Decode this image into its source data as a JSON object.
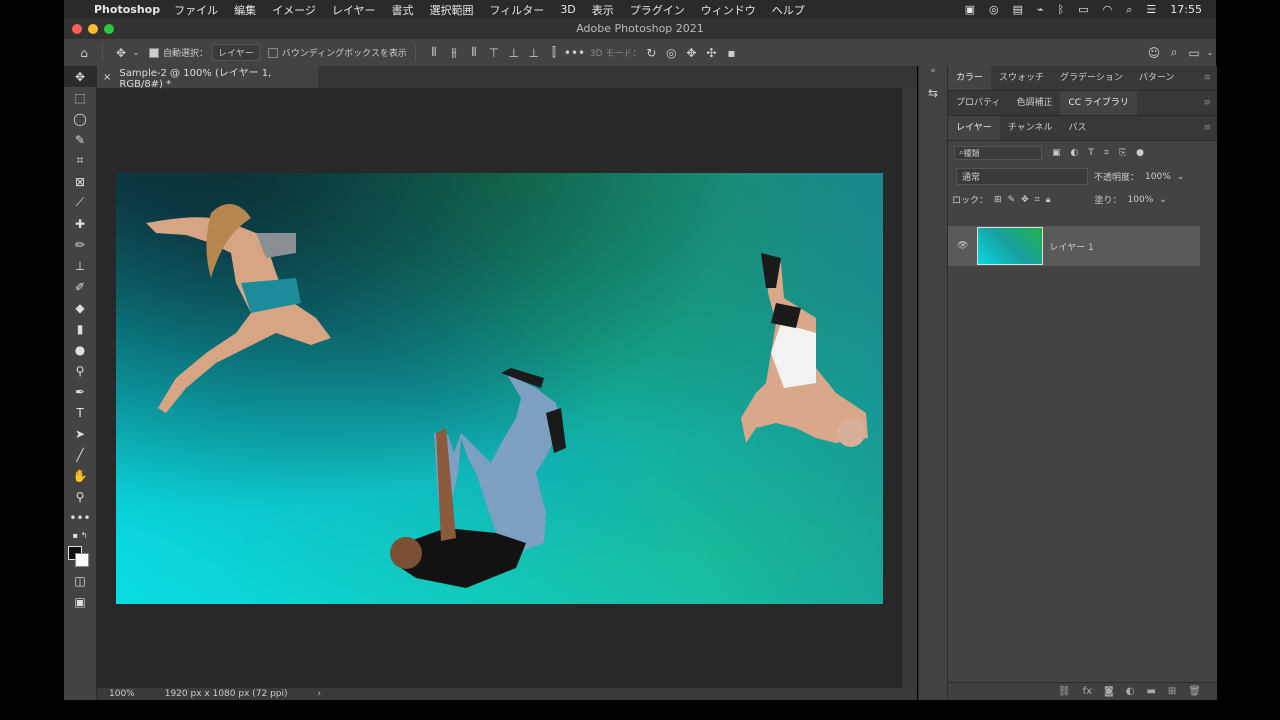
{
  "menubar": {
    "app": "Photoshop",
    "items": [
      "ファイル",
      "編集",
      "イメージ",
      "レイヤー",
      "書式",
      "選択範囲",
      "フィルター",
      "3D",
      "表示",
      "プラグイン",
      "ウィンドウ",
      "ヘルプ"
    ],
    "clock": "17:55"
  },
  "window": {
    "title": "Adobe Photoshop 2021"
  },
  "options": {
    "auto_select_label": "自動選択：",
    "auto_select_value": "レイヤー",
    "bounding_box_label": "バウンディングボックスを表示",
    "mode_3d_label": "3D モード："
  },
  "document": {
    "tab_title": "Sample-2 @ 100% (レイヤー 1, RGB/8#) *",
    "zoom": "100%",
    "info": "1920 px x 1080 px (72 ppi)"
  },
  "panels": {
    "group1_tabs": [
      "カラー",
      "スウォッチ",
      "グラデーション",
      "パターン"
    ],
    "group2_tabs": [
      "プロパティ",
      "色調補正",
      "CC ライブラリ"
    ],
    "group3_tabs": [
      "レイヤー",
      "チャンネル",
      "パス"
    ],
    "filter_label": "種類",
    "blend_mode": "通常",
    "opacity_label": "不透明度：",
    "opacity_value": "100%",
    "lock_label": "ロック：",
    "fill_label": "塗り：",
    "fill_value": "100%",
    "layer_name": "レイヤー 1"
  },
  "colors": {
    "accent_active_tab": "#434343",
    "canvas_cyan": "#08d8df",
    "canvas_green": "#22b04a"
  }
}
